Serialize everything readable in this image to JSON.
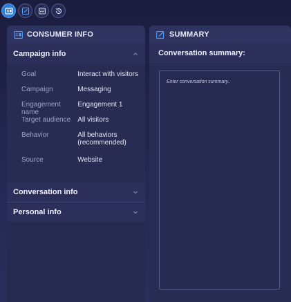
{
  "toolbar": {
    "buttons": [
      {
        "icon": "consumer-info-icon",
        "active": true
      },
      {
        "icon": "edit-note-icon",
        "active": false
      },
      {
        "icon": "widget-grid-icon",
        "active": false
      },
      {
        "icon": "history-icon",
        "active": false
      }
    ]
  },
  "consumer_panel": {
    "title": "CONSUMER INFO",
    "campaign": {
      "title": "Campaign info",
      "rows": [
        {
          "key": "Goal",
          "value": "Interact with visitors"
        },
        {
          "key": "Campaign",
          "value": "Messaging"
        },
        {
          "key": "Engagement name",
          "value": "Engagement 1"
        },
        {
          "key": "Target audience",
          "value": "All visitors"
        },
        {
          "key": "Behavior",
          "value": "All behaviors (recommended)"
        },
        {
          "key": "Source",
          "value": "Website"
        }
      ]
    },
    "conversation": {
      "title": "Conversation info"
    },
    "personal": {
      "title": "Personal info"
    }
  },
  "summary_panel": {
    "title": "SUMMARY",
    "label": "Conversation summary:",
    "placeholder": "Enter conversation summary.."
  },
  "colors": {
    "accent": "#2f7bd8",
    "panel": "#282b52",
    "background": "#1f2246"
  }
}
